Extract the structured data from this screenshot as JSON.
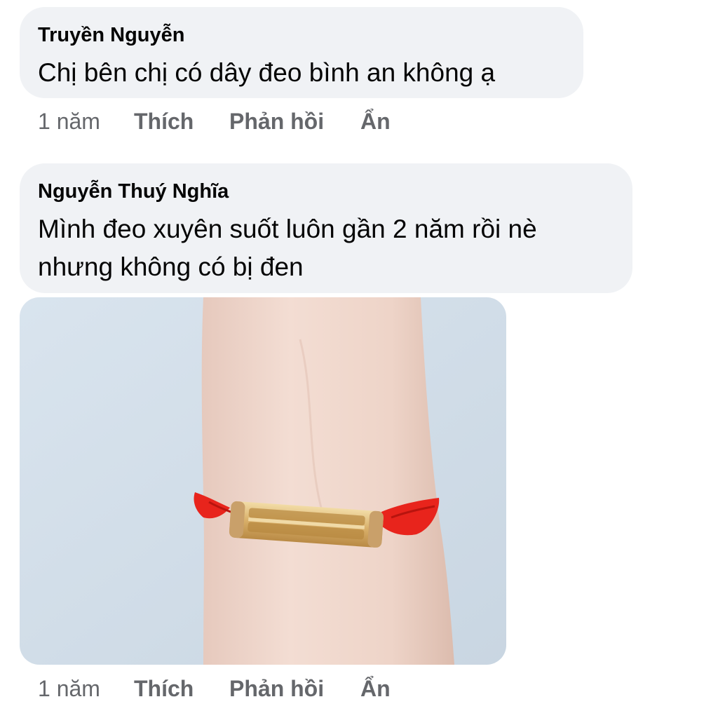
{
  "comments": [
    {
      "author": "Truyền Nguyễn",
      "lines": [
        "Chị bên chị có dây đeo bình an không ạ"
      ],
      "time": "1 năm",
      "like_label": "Thích",
      "reply_label": "Phản hồi",
      "hide_label": "Ẩn"
    },
    {
      "author": "Nguyễn Thuý Nghĩa",
      "lines": [
        "Mình đeo xuyên suốt luôn gần 2 năm rồi nè",
        "nhưng không có bị đen"
      ],
      "time": "1 năm",
      "like_label": "Thích",
      "reply_label": "Phản hồi",
      "hide_label": "Ẩn",
      "attachment": {
        "type": "photo",
        "subject": "wrist-with-red-string-gold-charm-bracelet"
      }
    }
  ],
  "colors": {
    "bubble_bg": "#f0f2f5",
    "text": "#050505",
    "secondary": "#65676b",
    "string_red": "#e8241c",
    "gold": "#d4aa5c"
  }
}
